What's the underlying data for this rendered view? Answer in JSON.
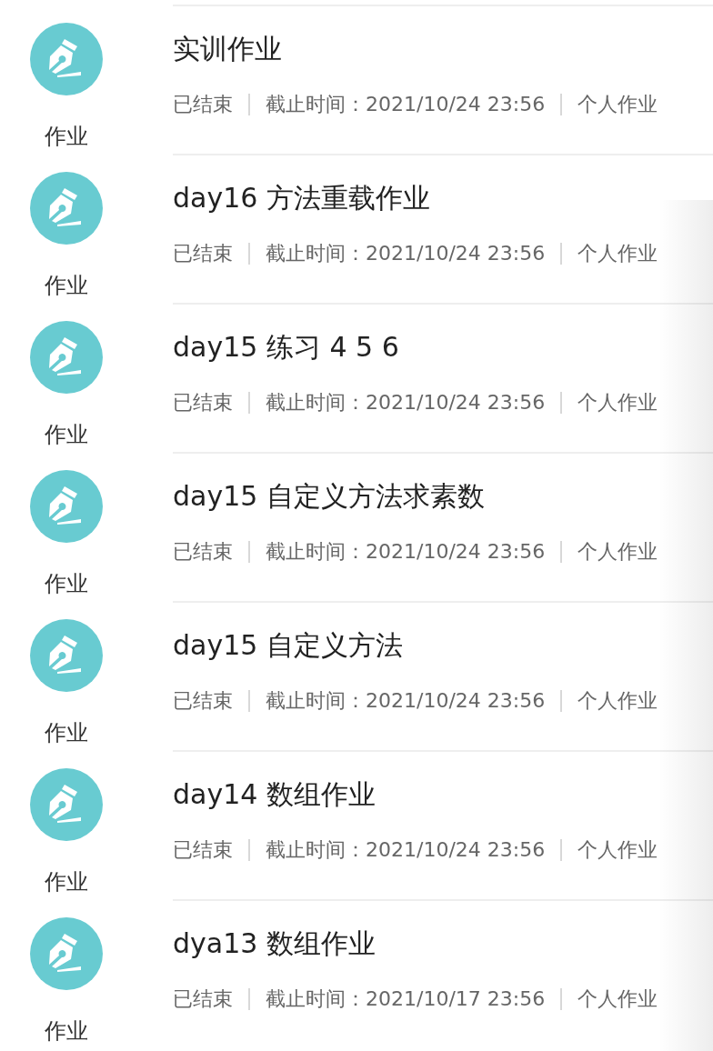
{
  "assignments": [
    {
      "icon_label": "作业",
      "title": "实训作业",
      "status": "已结束",
      "deadline": "截止时间：2021/10/24 23:56",
      "type": "个人作业"
    },
    {
      "icon_label": "作业",
      "title": "day16 方法重载作业",
      "status": "已结束",
      "deadline": "截止时间：2021/10/24 23:56",
      "type": "个人作业"
    },
    {
      "icon_label": "作业",
      "title": "day15 练习 4 5 6",
      "status": "已结束",
      "deadline": "截止时间：2021/10/24 23:56",
      "type": "个人作业"
    },
    {
      "icon_label": "作业",
      "title": "day15 自定义方法求素数",
      "status": "已结束",
      "deadline": "截止时间：2021/10/24 23:56",
      "type": "个人作业"
    },
    {
      "icon_label": "作业",
      "title": "day15 自定义方法",
      "status": "已结束",
      "deadline": "截止时间：2021/10/24 23:56",
      "type": "个人作业"
    },
    {
      "icon_label": "作业",
      "title": "day14 数组作业",
      "status": "已结束",
      "deadline": "截止时间：2021/10/24 23:56",
      "type": "个人作业"
    },
    {
      "icon_label": "作业",
      "title": "dya13 数组作业",
      "status": "已结束",
      "deadline": "截止时间：2021/10/17 23:56",
      "type": "个人作业"
    }
  ]
}
